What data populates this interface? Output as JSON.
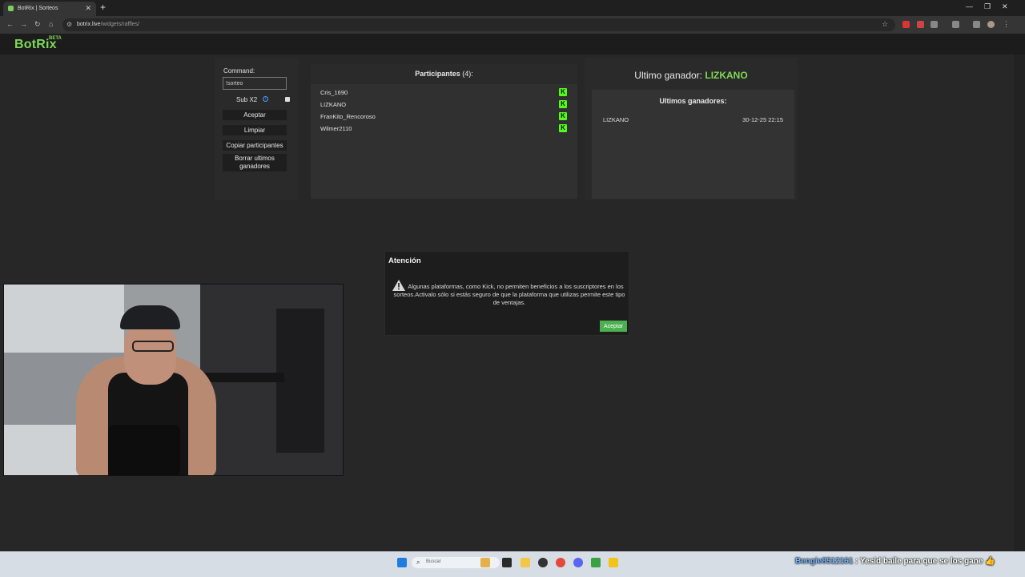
{
  "browser": {
    "tab_title": "BotRix | Sorteos",
    "url_host": "botrix.live",
    "url_path": "/widgets/raffles/"
  },
  "app": {
    "logo": "BotRix",
    "beta": "BETA"
  },
  "controls": {
    "command_label": "Command:",
    "command_value": "!sorteo",
    "sub_label": "Sub X2",
    "accept_label": "Aceptar",
    "clear_label": "Limpiar",
    "copy_label": "Copiar participantes",
    "delete_label": "Borrar ultimos ganadores"
  },
  "participants": {
    "title": "Participantes",
    "count": "(4):",
    "items": [
      {
        "name": "Cris_1690"
      },
      {
        "name": "LIZKANO"
      },
      {
        "name": "FranKito_Rencoroso"
      },
      {
        "name": "Wilmer2110"
      }
    ]
  },
  "winner": {
    "label": "Ultimo ganador:",
    "name": "LIZKANO",
    "list_title": "Ultimos ganadores:",
    "items": [
      {
        "name": "LIZKANO",
        "date": "30-12-25 22:15"
      }
    ]
  },
  "dialog": {
    "title": "Atención",
    "message": "Algunas plataformas, como Kick, no permiten beneficios a los suscriptores en los sorteos.Activalo sólo si estás seguro de que la plataforma que utilizas permite este tipo de ventajas.",
    "ok_label": "Aceptar"
  },
  "taskbar": {
    "search_placeholder": "Buscar"
  },
  "chat": {
    "user": "Bengie8512161",
    "separator": ":",
    "message": "Yesid baile para que se los gane"
  },
  "colors": {
    "brand_green": "#7ed957",
    "kick_green": "#53fc18",
    "ok_button": "#4caf50"
  }
}
